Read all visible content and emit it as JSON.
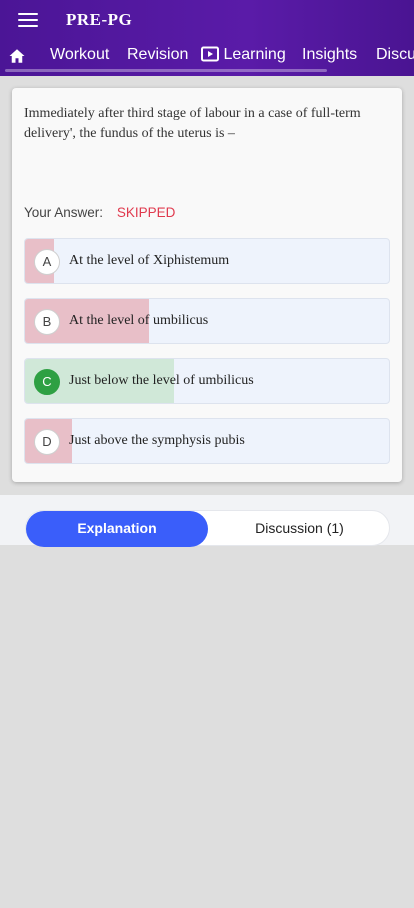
{
  "app": {
    "title": "PRE-PG"
  },
  "tabs": [
    {
      "label": "Workout"
    },
    {
      "label": "Revision"
    },
    {
      "label": "Learning"
    },
    {
      "label": "Insights"
    },
    {
      "label": "Discu"
    }
  ],
  "question": {
    "text": "Immediately after third stage of labour in a case of full-term delivery', the fundus of the uterus is –",
    "answer_label": "Your Answer:",
    "answer_value": "SKIPPED"
  },
  "options": [
    {
      "letter": "A",
      "text": "At the level of Xiphistemum",
      "response_share": 0.08,
      "correct": false
    },
    {
      "letter": "B",
      "text": "At the level of umbilicus",
      "response_share": 0.34,
      "correct": false
    },
    {
      "letter": "C",
      "text": "Just below the level of umbilicus",
      "response_share": 0.41,
      "correct": true
    },
    {
      "letter": "D",
      "text": "Just above the symphysis pubis",
      "response_share": 0.13,
      "correct": false
    }
  ],
  "colors": {
    "appbar": "#5a1ba8",
    "wrong_fill": "#e8bfc8",
    "correct_fill": "#d0e8d8",
    "accent": "#3a5efa",
    "skipped": "#e03a4e"
  },
  "bottom_tabs": {
    "explanation": "Explanation",
    "discussion": "Discussion (1)"
  }
}
